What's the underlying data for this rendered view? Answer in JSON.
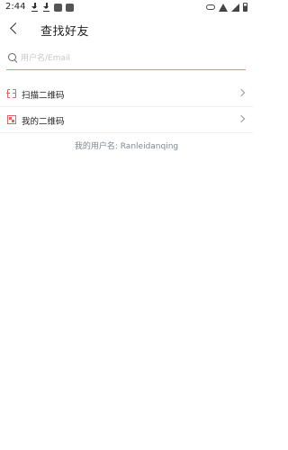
{
  "status_bar": {
    "time": "2:44",
    "left_icons": [
      "download-icon",
      "download-icon",
      "app-square-icon",
      "app-square-icon"
    ],
    "right_icons": [
      "link-icon",
      "wifi-icon",
      "cell-signal-icon",
      "battery-icon"
    ]
  },
  "header": {
    "back_icon": "chevron-left-icon",
    "title": "查找好友"
  },
  "search": {
    "icon": "search-icon",
    "placeholder": "用户名/Email",
    "value": "",
    "accent_color": "#e98a8a"
  },
  "menu": {
    "items": [
      {
        "icon": "scan-icon",
        "label": "扫描二维码"
      },
      {
        "icon": "qr-code-icon",
        "label": "我的二维码"
      }
    ],
    "icon_color": "#e06464"
  },
  "footer": {
    "username_text": "我的用户名: Ranleidanqing"
  }
}
